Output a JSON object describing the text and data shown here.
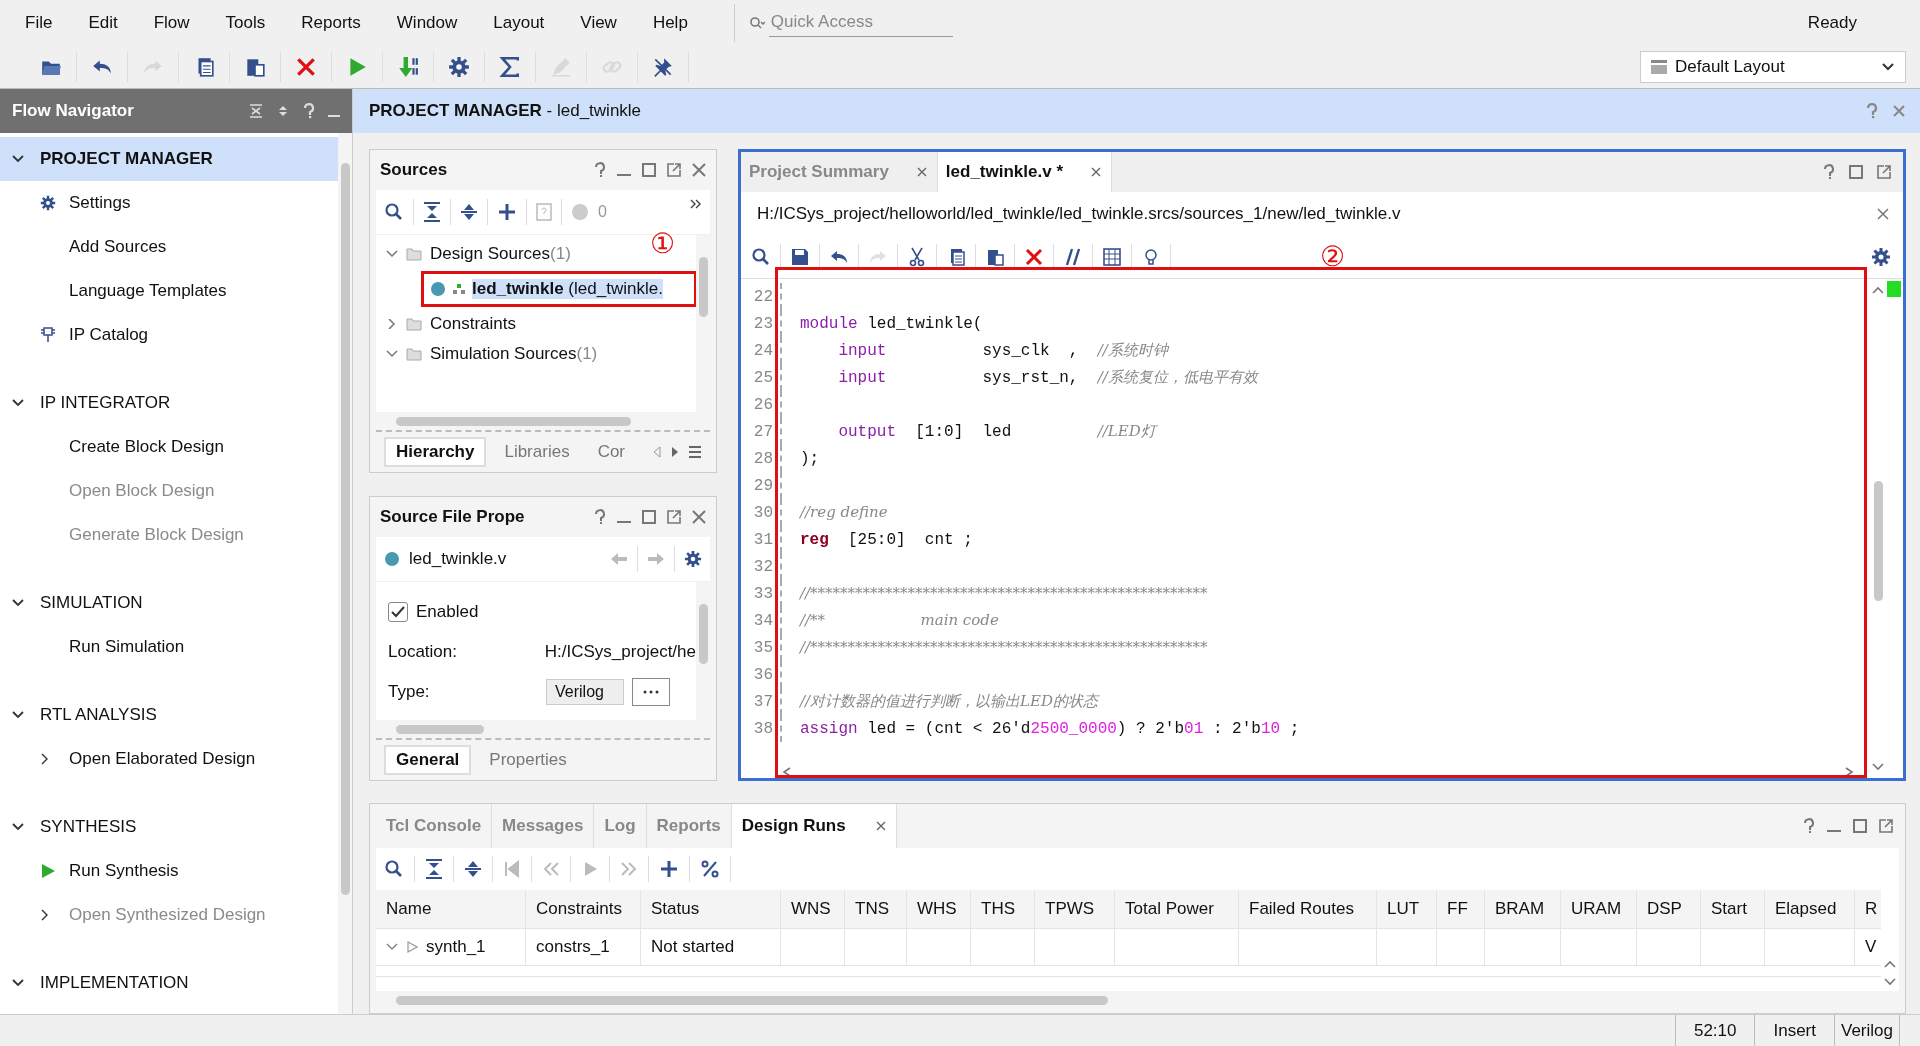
{
  "menu": [
    {
      "label": "File"
    },
    {
      "label": "Edit"
    },
    {
      "label": "Flow"
    },
    {
      "label": "Tools"
    },
    {
      "label": "Reports"
    },
    {
      "label": "Window"
    },
    {
      "label": "Layout"
    },
    {
      "label": "View"
    },
    {
      "label": "Help"
    }
  ],
  "quick_access": {
    "placeholder": "Quick Access"
  },
  "status": "Ready",
  "toolbar": [
    {
      "kind": "open",
      "disabled": false
    },
    {
      "kind": "undo",
      "disabled": false
    },
    {
      "kind": "redo",
      "disabled": true
    },
    {
      "kind": "copy",
      "disabled": false
    },
    {
      "kind": "paste",
      "disabled": false
    },
    {
      "kind": "delete",
      "disabled": false
    },
    {
      "kind": "run",
      "disabled": false
    },
    {
      "kind": "bitstream",
      "disabled": false
    },
    {
      "kind": "settings",
      "disabled": false
    },
    {
      "kind": "sigma",
      "disabled": false
    },
    {
      "kind": "pencil",
      "disabled": true
    },
    {
      "kind": "link",
      "disabled": true
    },
    {
      "kind": "pin",
      "disabled": false
    }
  ],
  "layout_select": {
    "value": "Default Layout"
  },
  "flow_navigator": {
    "title": "Flow Navigator",
    "sections": [
      {
        "title": "PROJECT MANAGER",
        "expanded": true,
        "selected": true,
        "items": [
          {
            "label": "Settings",
            "kind": "gear",
            "disabled": false
          },
          {
            "label": "Add Sources",
            "kind": "plain",
            "disabled": false
          },
          {
            "label": "Language Templates",
            "kind": "plain",
            "disabled": false
          },
          {
            "label": "IP Catalog",
            "kind": "chip",
            "disabled": false
          }
        ]
      },
      {
        "title": "IP INTEGRATOR",
        "expanded": true,
        "selected": false,
        "items": [
          {
            "label": "Create Block Design",
            "kind": "plain",
            "disabled": false
          },
          {
            "label": "Open Block Design",
            "kind": "plain",
            "disabled": true
          },
          {
            "label": "Generate Block Design",
            "kind": "plain",
            "disabled": true
          }
        ]
      },
      {
        "title": "SIMULATION",
        "expanded": true,
        "selected": false,
        "items": [
          {
            "label": "Run Simulation",
            "kind": "plain",
            "disabled": false
          }
        ]
      },
      {
        "title": "RTL ANALYSIS",
        "expanded": true,
        "selected": false,
        "items": [
          {
            "label": "Open Elaborated Design",
            "kind": "expandable",
            "disabled": false
          }
        ]
      },
      {
        "title": "SYNTHESIS",
        "expanded": true,
        "selected": false,
        "items": [
          {
            "label": "Run Synthesis",
            "kind": "run",
            "disabled": false
          },
          {
            "label": "Open Synthesized Design",
            "kind": "expandable",
            "disabled": true
          }
        ]
      },
      {
        "title": "IMPLEMENTATION",
        "expanded": true,
        "selected": false
      }
    ]
  },
  "header": {
    "title": "PROJECT MANAGER",
    "subtitle": "- led_twinkle"
  },
  "sources": {
    "title": "Sources",
    "warning_count": "0",
    "tree": [
      {
        "label": "Design Sources",
        "count": "(1)",
        "expanded": true,
        "children": [
          {
            "name": "led_twinkle",
            "file": "(led_twinkle.",
            "selected": true
          }
        ]
      },
      {
        "label": "Constraints",
        "expanded": false
      },
      {
        "label": "Simulation Sources",
        "count": "(1)",
        "expanded": true
      }
    ],
    "tabs": [
      {
        "label": "Hierarchy",
        "selected": true
      },
      {
        "label": "Libraries",
        "selected": false
      },
      {
        "label": "Cor",
        "selected": false
      }
    ]
  },
  "properties": {
    "title": "Source File Prope",
    "file": "led_twinkle.v",
    "enabled": {
      "label": "Enabled",
      "checked": true
    },
    "location_label": "Location:",
    "location": "H:/ICSys_project/he",
    "type_label": "Type:",
    "type": "Verilog",
    "tabs": [
      {
        "label": "General",
        "selected": true
      },
      {
        "label": "Properties",
        "selected": false
      }
    ]
  },
  "editor": {
    "tabs": [
      {
        "label": "Project Summary",
        "selected": false
      },
      {
        "label": "led_twinkle.v *",
        "selected": true
      }
    ],
    "path": "H:/ICSys_project/helloworld/led_twinkle/led_twinkle.srcs/sources_1/new/led_twinkle.v",
    "lines": [
      {
        "num": "22"
      },
      {
        "num": "23",
        "tokens": [
          {
            "kind": "keyword",
            "text": "module"
          },
          {
            "kind": "plain",
            "text": " led_twinkle("
          }
        ]
      },
      {
        "num": "24",
        "tokens": [
          {
            "kind": "keyword",
            "text": "    input"
          },
          {
            "kind": "plain",
            "text": "          sys_clk  ,  "
          },
          {
            "kind": "comment",
            "text": "//系统时钟"
          }
        ]
      },
      {
        "num": "25",
        "tokens": [
          {
            "kind": "keyword",
            "text": "    input"
          },
          {
            "kind": "plain",
            "text": "          sys_rst_n,  "
          },
          {
            "kind": "comment",
            "text": "//系统复位，低电平有效"
          }
        ]
      },
      {
        "num": "26"
      },
      {
        "num": "27",
        "tokens": [
          {
            "kind": "keyword",
            "text": "    output"
          },
          {
            "kind": "plain",
            "text": "  [1:0]  led         "
          },
          {
            "kind": "comment",
            "text": "//LED灯"
          }
        ]
      },
      {
        "num": "28",
        "tokens": [
          {
            "kind": "plain",
            "text": ");"
          }
        ]
      },
      {
        "num": "29"
      },
      {
        "num": "30",
        "tokens": [
          {
            "kind": "comment",
            "text": "//reg define"
          }
        ]
      },
      {
        "num": "31",
        "tokens": [
          {
            "kind": "reg",
            "text": "reg"
          },
          {
            "kind": "plain",
            "text": "  [25:0]  cnt ;"
          }
        ]
      },
      {
        "num": "32"
      },
      {
        "num": "33",
        "tokens": [
          {
            "kind": "comment",
            "text": "//*****************************************************"
          }
        ]
      },
      {
        "num": "34",
        "tokens": [
          {
            "kind": "comment",
            "text": "//**                    main code"
          }
        ]
      },
      {
        "num": "35",
        "tokens": [
          {
            "kind": "comment",
            "text": "//*****************************************************"
          }
        ]
      },
      {
        "num": "36"
      },
      {
        "num": "37",
        "tokens": [
          {
            "kind": "comment",
            "text": "//对计数器的值进行判断，以输出LED的状态"
          }
        ]
      },
      {
        "num": "38",
        "tokens": [
          {
            "kind": "keyword",
            "text": "assign"
          },
          {
            "kind": "plain",
            "text": " led = (cnt < 26'd"
          },
          {
            "kind": "number",
            "text": "2500_0000"
          },
          {
            "kind": "plain",
            "text": ") ? 2'b"
          },
          {
            "kind": "number",
            "text": "01"
          },
          {
            "kind": "plain",
            "text": " : 2'b"
          },
          {
            "kind": "number",
            "text": "10"
          },
          {
            "kind": "plain",
            "text": " ;"
          }
        ]
      }
    ]
  },
  "annotations": [
    {
      "label": "①"
    },
    {
      "label": "②"
    }
  ],
  "bottom": {
    "tabs": [
      {
        "label": "Tcl Console",
        "selected": false
      },
      {
        "label": "Messages",
        "selected": false
      },
      {
        "label": "Log",
        "selected": false
      },
      {
        "label": "Reports",
        "selected": false
      },
      {
        "label": "Design Runs",
        "selected": true
      }
    ],
    "columns": [
      "Name",
      "Constraints",
      "Status",
      "WNS",
      "TNS",
      "WHS",
      "THS",
      "TPWS",
      "Total Power",
      "Failed Routes",
      "LUT",
      "FF",
      "BRAM",
      "URAM",
      "DSP",
      "Start",
      "Elapsed",
      "R"
    ],
    "rows": [
      {
        "expanded": true,
        "cells": {
          "0": "synth_1",
          "1": "constrs_1",
          "2": "Not started",
          "17": "V"
        }
      }
    ]
  },
  "status_bar": [
    "52:10",
    "Insert",
    "Verilog"
  ]
}
